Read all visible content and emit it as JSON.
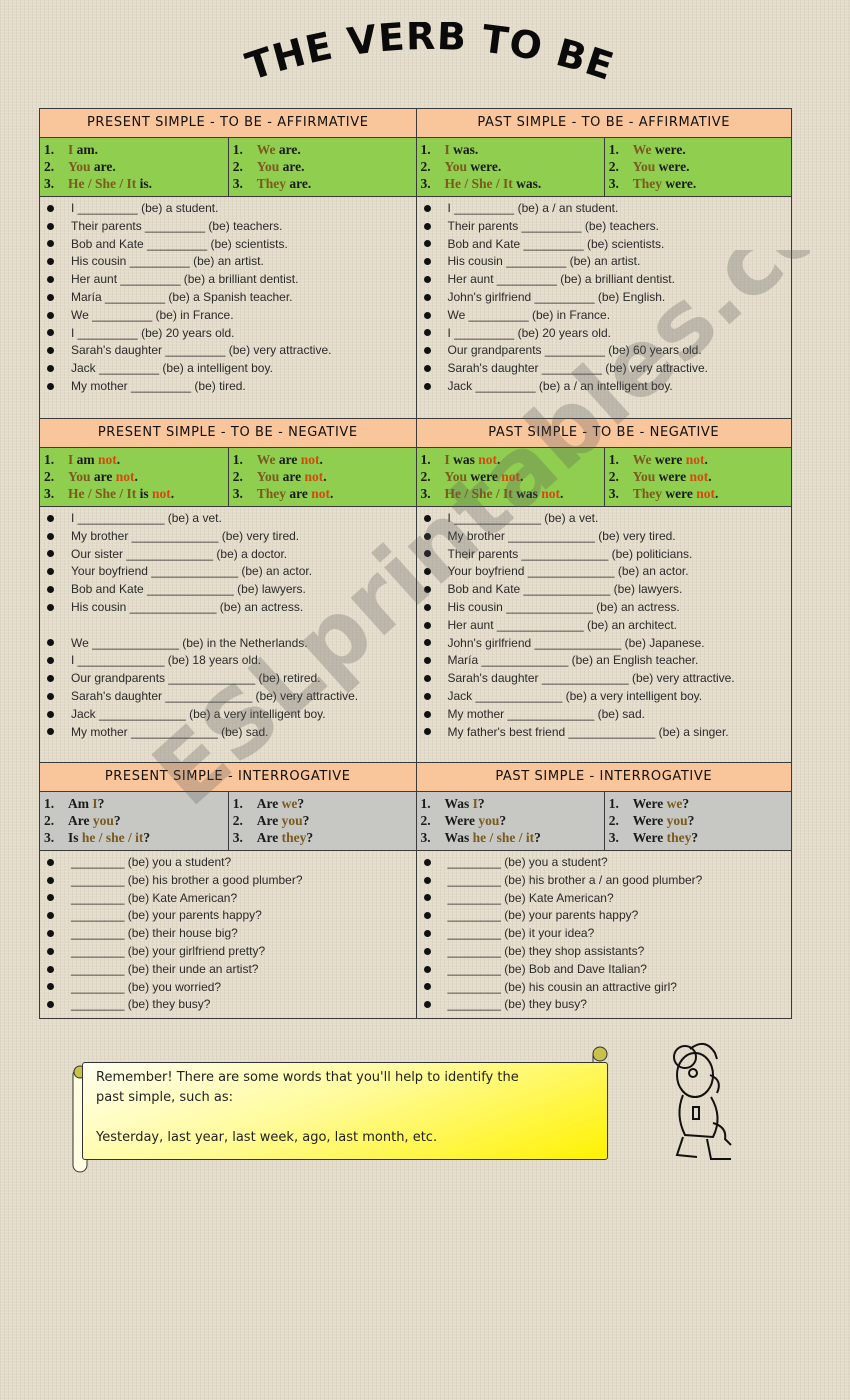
{
  "title": "THE VERB TO BE",
  "watermark": "ESLprintables.com",
  "sections": {
    "present_affirmative": {
      "header": "PRESENT SIMPLE - TO BE - AFFIRMATIVE",
      "left": [
        {
          "num": "1.",
          "pron": "I",
          "verb": " am."
        },
        {
          "num": "2.",
          "pron": "You",
          "verb": " are."
        },
        {
          "num": "3.",
          "pron": "He / She / It",
          "verb": " is."
        }
      ],
      "right": [
        {
          "num": "1.",
          "pron": "We",
          "verb": " are."
        },
        {
          "num": "2.",
          "pron": "You",
          "verb": " are."
        },
        {
          "num": "3.",
          "pron": "They",
          "verb": " are."
        }
      ],
      "exercises": [
        "I _________ (be) a student.",
        "Their parents _________ (be) teachers.",
        "Bob and Kate _________ (be) scientists.",
        "His cousin _________ (be) an artist.",
        "Her aunt _________ (be) a brilliant dentist.",
        "María _________ (be) a Spanish teacher.",
        "We _________ (be) in France.",
        "I _________ (be) 20 years old.",
        "Sarah's daughter _________ (be) very attractive.",
        "Jack _________ (be) a intelligent boy.",
        "My mother _________ (be) tired."
      ]
    },
    "past_affirmative": {
      "header": "PAST SIMPLE  - TO BE - AFFIRMATIVE",
      "left": [
        {
          "num": "1.",
          "pron": "I",
          "verb": " was."
        },
        {
          "num": "2.",
          "pron": "You",
          "verb": " were."
        },
        {
          "num": "3.",
          "pron": "He / She / It",
          "verb": " was."
        }
      ],
      "right": [
        {
          "num": "1.",
          "pron": "We",
          "verb": " were."
        },
        {
          "num": "2.",
          "pron": "You",
          "verb": " were."
        },
        {
          "num": "3.",
          "pron": "They",
          "verb": " were."
        }
      ],
      "exercises": [
        "I _________ (be) a / an student.",
        "Their parents _________ (be) teachers.",
        "Bob and Kate _________ (be) scientists.",
        "His cousin _________ (be) an artist.",
        "Her aunt _________ (be) a brilliant dentist.",
        "John's girlfriend _________ (be) English.",
        "We _________ (be) in France.",
        "I _________ (be) 20 years old.",
        "Our grandparents _________ (be) 60 years old.",
        "Sarah's daughter _________ (be) very attractive.",
        "Jack _________ (be) a / an intelligent boy."
      ]
    },
    "present_negative": {
      "header": "PRESENT SIMPLE - TO BE -  NEGATIVE",
      "left": [
        {
          "num": "1.",
          "pron": "I",
          "verb": " am ",
          "neg": "not",
          "end": "."
        },
        {
          "num": "2.",
          "pron": "You",
          "verb": " are ",
          "neg": "not",
          "end": "."
        },
        {
          "num": "3.",
          "pron": "He / She / It",
          "verb": " is ",
          "neg": "not",
          "end": "."
        }
      ],
      "right": [
        {
          "num": "1.",
          "pron": "We",
          "verb": " are ",
          "neg": "not",
          "end": "."
        },
        {
          "num": "2.",
          "pron": "You",
          "verb": " are ",
          "neg": "not",
          "end": "."
        },
        {
          "num": "3.",
          "pron": "They",
          "verb": " are ",
          "neg": "not",
          "end": "."
        }
      ],
      "exercises": [
        "I _____________ (be) a vet.",
        "My brother _____________ (be) very tired.",
        "Our sister _____________ (be) a doctor.",
        "Your boyfriend _____________ (be) an actor.",
        "Bob and Kate _____________ (be) lawyers.",
        "His cousin _____________ (be) an actress.",
        "",
        "We _____________ (be) in the Netherlands.",
        "I _____________ (be) 18 years old.",
        "Our grandparents _____________ (be) retired.",
        "Sarah's daughter _____________ (be) very attractive.",
        "Jack _____________ (be) a very intelligent boy.",
        "My mother _____________ (be) sad."
      ]
    },
    "past_negative": {
      "header": "PAST SIMPLE - TO BE -  NEGATIVE",
      "left": [
        {
          "num": "1.",
          "pron": "I",
          "verb": " was ",
          "neg": "not",
          "end": "."
        },
        {
          "num": "2.",
          "pron": "You",
          "verb": " were ",
          "neg": "not",
          "end": "."
        },
        {
          "num": "3.",
          "pron": "He / She / It",
          "verb": " was ",
          "neg": "not",
          "end": "."
        }
      ],
      "right": [
        {
          "num": "1.",
          "pron": "We",
          "verb": " were ",
          "neg": "not",
          "end": "."
        },
        {
          "num": "2.",
          "pron": "You",
          "verb": " were ",
          "neg": "not",
          "end": "."
        },
        {
          "num": "3.",
          "pron": "They",
          "verb": " were ",
          "neg": "not",
          "end": "."
        }
      ],
      "exercises": [
        "I _____________ (be) a vet.",
        "My brother _____________ (be) very tired.",
        "Their parents _____________ (be) politicians.",
        "Your boyfriend _____________ (be) an actor.",
        "Bob and Kate _____________ (be) lawyers.",
        "His cousin _____________ (be) an actress.",
        "Her aunt _____________ (be) an architect.",
        "John's girlfriend _____________ (be) Japanese.",
        "María _____________ (be) an English teacher.",
        "Sarah's daughter _____________ (be) very attractive.",
        "Jack _____________ (be) a very intelligent boy.",
        "My mother _____________ (be) sad.",
        "My father's best friend _____________ (be) a singer."
      ]
    },
    "present_interrogative": {
      "header": "PRESENT SIMPLE - INTERROGATIVE",
      "left": [
        {
          "num": "1.",
          "verb": "Am ",
          "pron": "I",
          "end": "?"
        },
        {
          "num": "2.",
          "verb": "Are ",
          "pron": "you",
          "end": "?"
        },
        {
          "num": "3.",
          "verb": "Is ",
          "pron": "he / she / it",
          "end": "?"
        }
      ],
      "right": [
        {
          "num": "1.",
          "verb": "Are ",
          "pron": "we",
          "end": "?"
        },
        {
          "num": "2.",
          "verb": "Are ",
          "pron": "you",
          "end": "?"
        },
        {
          "num": "3.",
          "verb": "Are ",
          "pron": "they",
          "end": "?"
        }
      ],
      "exercises": [
        "________ (be) you a student?",
        "________ (be) his brother a good plumber?",
        "________ (be) Kate American?",
        "________ (be) your parents happy?",
        "________ (be) their house big?",
        "________ (be) your girlfriend pretty?",
        "________ (be) their unde an artist?",
        "________ (be) you worried?",
        "________ (be) they busy?"
      ]
    },
    "past_interrogative": {
      "header": "PAST SIMPLE - INTERROGATIVE",
      "left": [
        {
          "num": "1.",
          "verb": "Was ",
          "pron": "I",
          "end": "?"
        },
        {
          "num": "2.",
          "verb": "Were ",
          "pron": "you",
          "end": "?"
        },
        {
          "num": "3.",
          "verb": "Was ",
          "pron": "he / she / it",
          "end": "?"
        }
      ],
      "right": [
        {
          "num": "1.",
          "verb": "Were ",
          "pron": "we",
          "end": "?"
        },
        {
          "num": "2.",
          "verb": "Were ",
          "pron": "you",
          "end": "?"
        },
        {
          "num": "3.",
          "verb": "Were ",
          "pron": "they",
          "end": "?"
        }
      ],
      "exercises": [
        "________ (be) you a student?",
        "________ (be) his brother a / an good plumber?",
        "________ (be) Kate American?",
        "________ (be) your parents happy?",
        "________ (be) it your idea?",
        "________ (be) they shop assistants?",
        "________ (be) Bob and Dave Italian?",
        "________ (be) his cousin an attractive girl?",
        "________ (be) they busy?"
      ]
    }
  },
  "remember": {
    "line1": "Remember! There are some words that you'll help to identify the",
    "line2": "past simple, such as:",
    "line3": "Yesterday, last year, last week, ago, last month, etc."
  },
  "icons": {
    "mascot": "cartoon-mouse-illustration",
    "scroll": "paper-scroll-banner"
  },
  "colors": {
    "header_bg": "#f9c59b",
    "affirm_bg": "#8fce4f",
    "interrog_bg": "#c7c7c4",
    "pronoun": "#7a5a1e",
    "negative": "#d24a12"
  }
}
